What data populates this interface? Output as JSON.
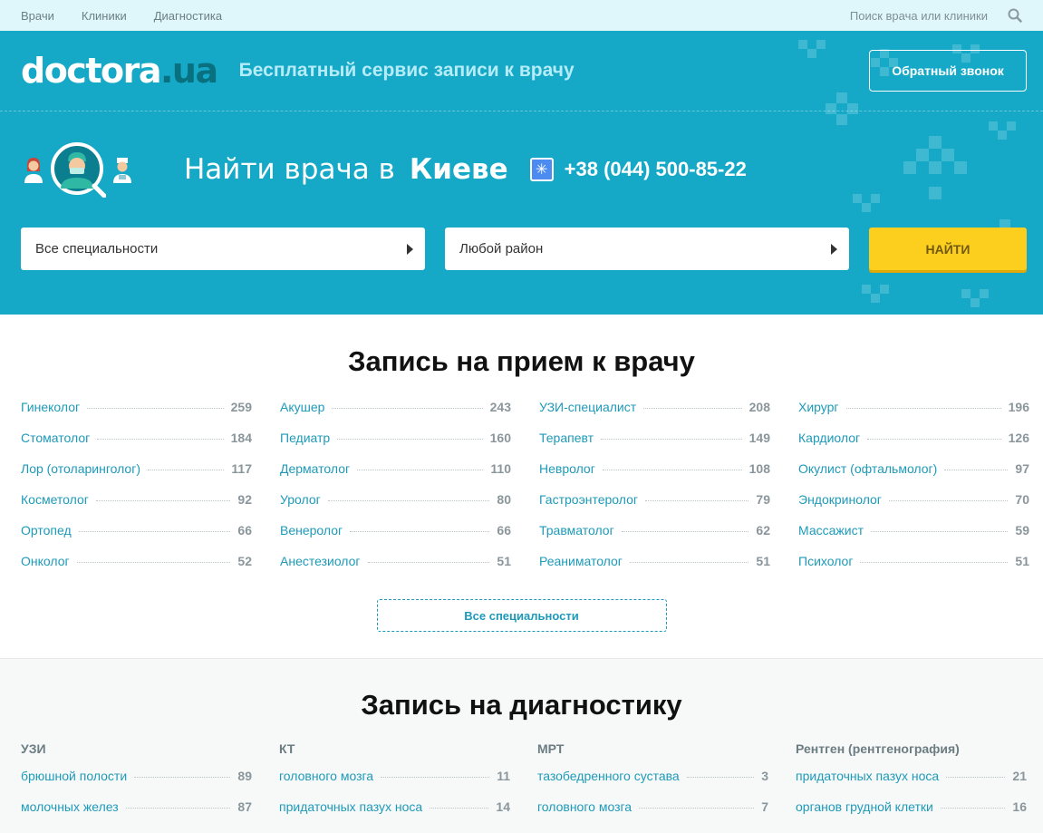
{
  "topnav": {
    "items": [
      "Врачи",
      "Клиники",
      "Диагностика"
    ],
    "search_label": "Поиск врача или клиники"
  },
  "header": {
    "logo_main": "doctora",
    "logo_suffix": ".ua",
    "tagline": "Бесплатный сервис записи к врачу",
    "callback_label": "Обратный звонок"
  },
  "find": {
    "title": "Найти врача в",
    "city": "Киеве",
    "phone": "+38 (044) 500-85-22"
  },
  "search": {
    "specialty": "Все специальности",
    "district": "Любой район",
    "submit": "НАЙТИ"
  },
  "doctors": {
    "title": "Запись на прием к врачу",
    "columns": [
      [
        {
          "name": "Гинеколог",
          "count": "259"
        },
        {
          "name": "Стоматолог",
          "count": "184"
        },
        {
          "name": "Лор (отоларинголог)",
          "count": "117"
        },
        {
          "name": "Косметолог",
          "count": "92"
        },
        {
          "name": "Ортопед",
          "count": "66"
        },
        {
          "name": "Онколог",
          "count": "52"
        }
      ],
      [
        {
          "name": "Акушер",
          "count": "243"
        },
        {
          "name": "Педиатр",
          "count": "160"
        },
        {
          "name": "Дерматолог",
          "count": "110"
        },
        {
          "name": "Уролог",
          "count": "80"
        },
        {
          "name": "Венеролог",
          "count": "66"
        },
        {
          "name": "Анестезиолог",
          "count": "51"
        }
      ],
      [
        {
          "name": "УЗИ-специалист",
          "count": "208"
        },
        {
          "name": "Терапевт",
          "count": "149"
        },
        {
          "name": "Невролог",
          "count": "108"
        },
        {
          "name": "Гастроэнтеролог",
          "count": "79"
        },
        {
          "name": "Травматолог",
          "count": "62"
        },
        {
          "name": "Реаниматолог",
          "count": "51"
        }
      ],
      [
        {
          "name": "Хирург",
          "count": "196"
        },
        {
          "name": "Кардиолог",
          "count": "126"
        },
        {
          "name": "Окулист (офтальмолог)",
          "count": "97"
        },
        {
          "name": "Эндокринолог",
          "count": "70"
        },
        {
          "name": "Массажист",
          "count": "59"
        },
        {
          "name": "Психолог",
          "count": "51"
        }
      ]
    ],
    "all_label": "Все специальности"
  },
  "diagnostics": {
    "title": "Запись на диагностику",
    "columns": [
      {
        "head": "УЗИ",
        "items": [
          {
            "name": "брюшной полости",
            "count": "89"
          },
          {
            "name": "молочных желез",
            "count": "87"
          }
        ]
      },
      {
        "head": "КТ",
        "items": [
          {
            "name": "головного мозга",
            "count": "11"
          },
          {
            "name": "придаточных пазух носа",
            "count": "14"
          }
        ]
      },
      {
        "head": "МРТ",
        "items": [
          {
            "name": "тазобедренного сустава",
            "count": "3"
          },
          {
            "name": "головного мозга",
            "count": "7"
          }
        ]
      },
      {
        "head": "Рентген (рентгенография)",
        "items": [
          {
            "name": "придаточных пазух носа",
            "count": "21"
          },
          {
            "name": "органов грудной клетки",
            "count": "16"
          }
        ]
      }
    ]
  }
}
